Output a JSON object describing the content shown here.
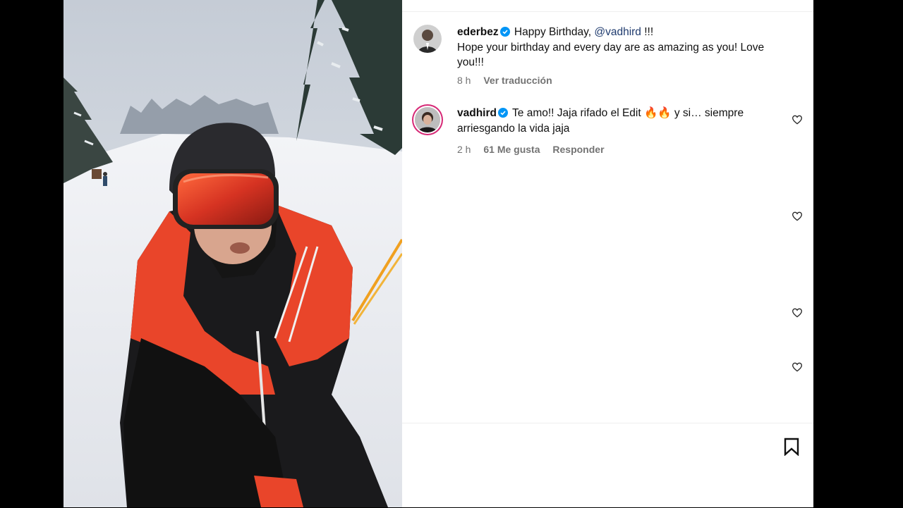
{
  "comments": [
    {
      "username": "ederbez",
      "text_prefix": "Happy Birthday, ",
      "mention": "@vadhird",
      "text_suffix": " !!!",
      "text_line2": "Hope your birthday and every day are as amazing as you! Love you!!!",
      "time": "8 h",
      "translate": "Ver traducción"
    },
    {
      "username": "vadhird",
      "text": "Te amo!! Jaja rifado el Edit 🔥🔥 y si… siempre arriesgando la vida jaja",
      "time": "2 h",
      "likes": "61 Me gusta",
      "reply": "Responder"
    }
  ],
  "icons": {
    "verified": "verified-badge-icon",
    "like": "heart-icon",
    "save": "bookmark-icon"
  },
  "colors": {
    "verified": "#0095f6",
    "mention": "#00376b",
    "secondary": "#737373"
  }
}
